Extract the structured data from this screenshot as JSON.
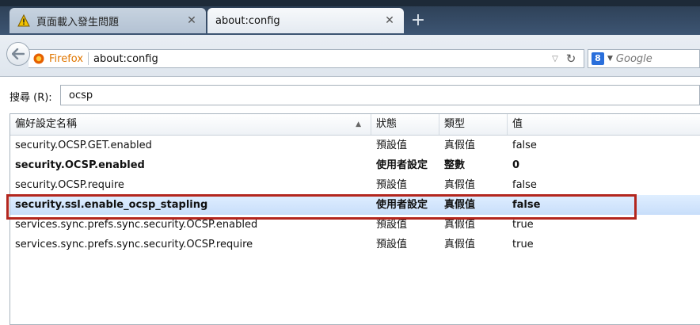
{
  "tabs": [
    {
      "title": "頁面載入發生問題",
      "active": false
    },
    {
      "title": "about:config",
      "active": true
    }
  ],
  "new_tab_label": "+",
  "navbar": {
    "site_name": "Firefox",
    "url": "about:config",
    "search_engine_letter": "8",
    "search_placeholder": "Google"
  },
  "search": {
    "label": "搜尋 (R):",
    "value": "ocsp"
  },
  "table": {
    "headers": [
      "偏好設定名稱",
      "狀態",
      "類型",
      "值"
    ],
    "rows": [
      {
        "name": "security.OCSP.GET.enabled",
        "status": "預設值",
        "type": "真假值",
        "value": "false",
        "bold": false,
        "selected": false
      },
      {
        "name": "security.OCSP.enabled",
        "status": "使用者設定",
        "type": "整數",
        "value": "0",
        "bold": true,
        "selected": false
      },
      {
        "name": "security.OCSP.require",
        "status": "預設值",
        "type": "真假值",
        "value": "false",
        "bold": false,
        "selected": false
      },
      {
        "name": "security.ssl.enable_ocsp_stapling",
        "status": "使用者設定",
        "type": "真假值",
        "value": "false",
        "bold": true,
        "selected": true
      },
      {
        "name": "services.sync.prefs.sync.security.OCSP.enabled",
        "status": "預設值",
        "type": "真假值",
        "value": "true",
        "bold": false,
        "selected": false
      },
      {
        "name": "services.sync.prefs.sync.security.OCSP.require",
        "status": "預設值",
        "type": "真假值",
        "value": "true",
        "bold": false,
        "selected": false
      }
    ]
  },
  "colors": {
    "highlight_border": "#b3261e",
    "firefox_orange": "#e07600"
  }
}
